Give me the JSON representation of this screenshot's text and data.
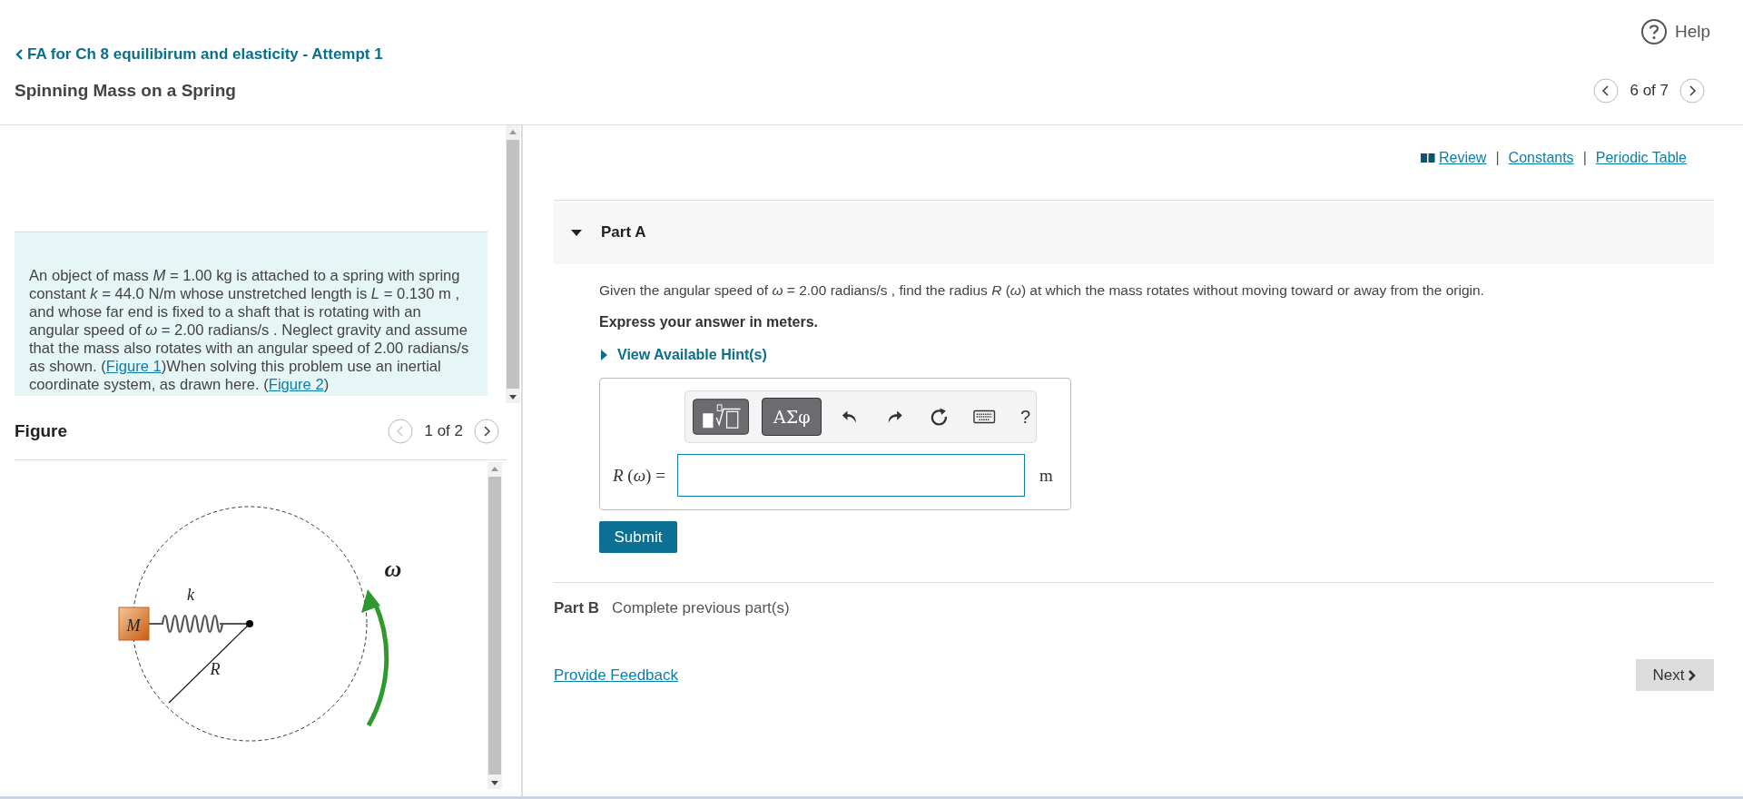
{
  "header": {
    "help": "Help",
    "back_link": "FA for Ch 8 equilibirum and elasticity - Attempt 1",
    "title": "Spinning Mass on a Spring",
    "pager": "6 of 7"
  },
  "intro": [
    {
      "text": "An object of mass *M* = 1.00 kg is attached to a spring with spring constant *k* = 44.0 N/m whose unstretched length is *L* = 0.130 m , and whose far end is fixed to a shaft that is rotating with an angular speed of *ω* = 2.00 radians/s . Neglect gravity and assume that the mass also rotates with an angular speed of 2.00 radians/s as shown. ("
    },
    {
      "link": "Figure 1"
    },
    {
      "text": ")When solving this problem use an inertial coordinate system, as drawn here. ("
    },
    {
      "link": "Figure 2"
    },
    {
      "text": ")"
    }
  ],
  "figure": {
    "heading": "Figure",
    "pager": "1 of 2",
    "labels": {
      "mass": "M",
      "spring": "k",
      "radius": "R",
      "omega": "ω"
    }
  },
  "links": {
    "items": [
      "Review",
      "Constants",
      "Periodic Table"
    ],
    "separator": "|"
  },
  "part_a": {
    "label": "Part A",
    "expanded": true,
    "question": "Given the angular speed of *ω* = 2.00 radians/s , find the radius *R* (*ω*) at which the mass rotates without moving toward or away from the origin.",
    "instruction": "Express your answer in meters.",
    "hints": {
      "label": "View Available Hint(s)",
      "expanded": false
    },
    "toolbar": [
      {
        "kind": "templates"
      },
      {
        "kind": "symbols",
        "label": "ΑΣφ"
      },
      {
        "kind": "undo"
      },
      {
        "kind": "redo"
      },
      {
        "kind": "reset"
      },
      {
        "kind": "keyboard"
      },
      {
        "kind": "help",
        "label": "?"
      }
    ],
    "answer_label": "*R* (*ω*) =",
    "unit": "m",
    "submit": "Submit"
  },
  "part_b": {
    "label": "Part B",
    "status": "Complete previous part(s)"
  },
  "feedback_link": "Provide Feedback",
  "next": "Next"
}
